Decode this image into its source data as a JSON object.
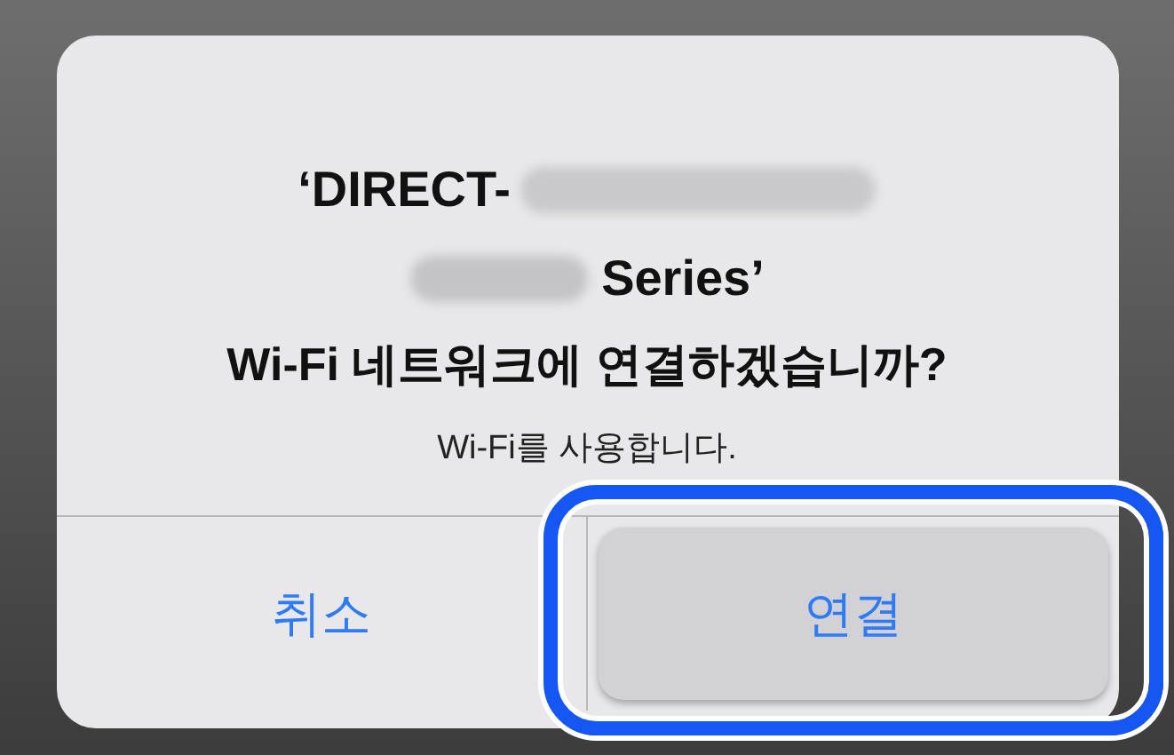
{
  "alert": {
    "title_parts": [
      "‘DIRECT-",
      "Series’"
    ],
    "question": "Wi-Fi 네트워크에 연결하겠습니까?",
    "message": "Wi-Fi를 사용합니다.",
    "buttons": [
      {
        "label": "취소",
        "selected": false
      },
      {
        "label": "연결",
        "selected": true
      }
    ]
  }
}
